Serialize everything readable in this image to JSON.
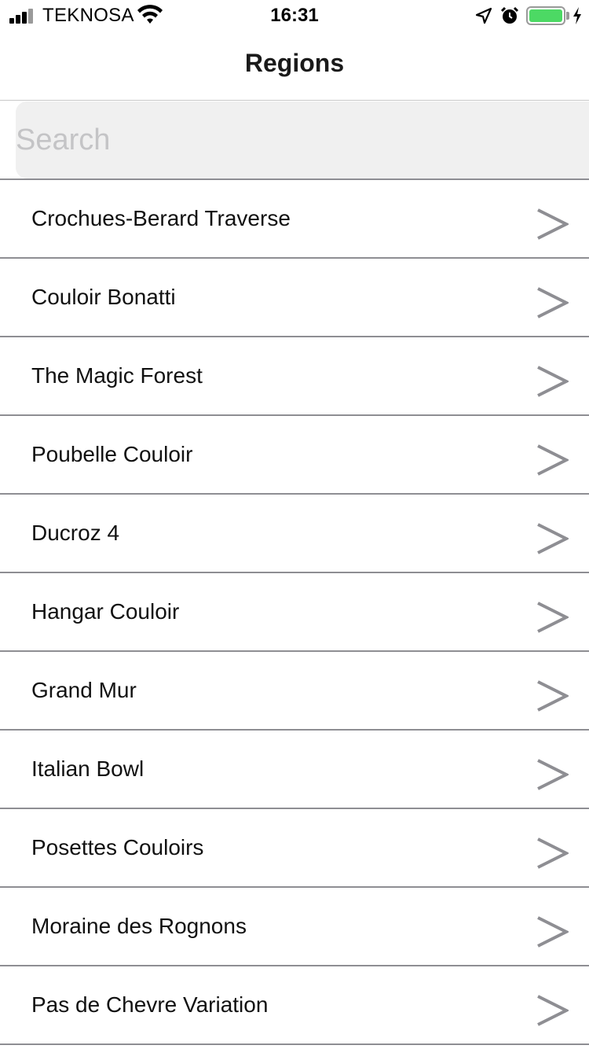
{
  "status_bar": {
    "carrier": "TEKNOSA",
    "time": "16:31",
    "signal_icon": "cellular-signal-icon",
    "wifi_icon": "wifi-icon",
    "location_icon": "location-arrow-icon",
    "alarm_icon": "alarm-clock-icon",
    "battery_icon": "battery-icon",
    "charging_icon": "charging-bolt-icon",
    "battery_level": 1.0,
    "battery_color": "#4cd964"
  },
  "nav": {
    "title": "Regions"
  },
  "search": {
    "placeholder": "Search",
    "value": ""
  },
  "regions": [
    {
      "label": "Crochues-Berard Traverse"
    },
    {
      "label": "Couloir Bonatti"
    },
    {
      "label": "The Magic Forest"
    },
    {
      "label": "Poubelle Couloir"
    },
    {
      "label": "Ducroz 4"
    },
    {
      "label": "Hangar Couloir"
    },
    {
      "label": "Grand Mur"
    },
    {
      "label": "Italian Bowl"
    },
    {
      "label": "Posettes Couloirs"
    },
    {
      "label": "Moraine des Rognons"
    },
    {
      "label": "Pas de Chevre Variation"
    }
  ],
  "colors": {
    "chevron": "#8e8e93",
    "separator": "#8e8e93",
    "search_bg": "#f0f0f0"
  }
}
